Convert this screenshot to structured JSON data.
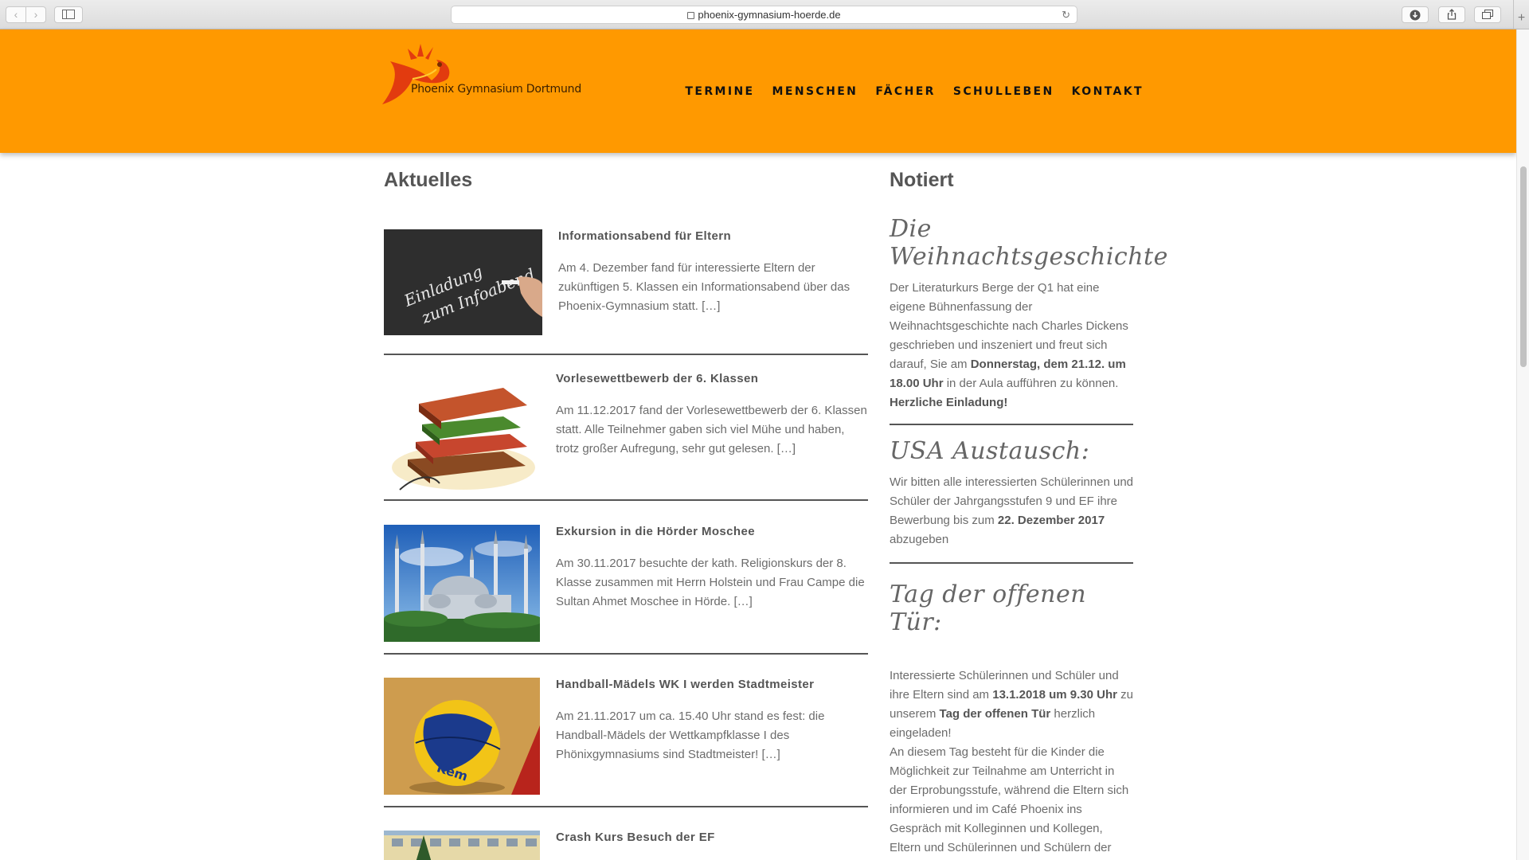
{
  "browser": {
    "url": "phoenix-gymnasium-hoerde.de",
    "back_glyph": "‹",
    "forward_glyph": "›",
    "reload_glyph": "↻",
    "new_tab_glyph": "+"
  },
  "site": {
    "logo_text": "Phoenix Gymnasium Dortmund",
    "nav": [
      "TERMINE",
      "MENSCHEN",
      "FÄCHER",
      "SCHULLEBEN",
      "KONTAKT"
    ],
    "colors": {
      "header": "#ff9900",
      "text": "#555555"
    }
  },
  "aktuelles": {
    "title": "Aktuelles",
    "chalkboard_text": [
      "Einladung",
      "zum Infoabend"
    ],
    "posts": [
      {
        "title": "Informationsabend für Eltern",
        "excerpt": "Am 4. Dezember fand für interessierte Eltern der zukünftigen 5. Klassen ein Informationsabend über das Phoenix-Gymnasium statt.",
        "more": "[…]",
        "image": "chalkboard-image"
      },
      {
        "title": "Vorlesewettbewerb der 6. Klassen",
        "excerpt": "Am 11.12.2017 fand der Vorlesewettbewerb der 6. Klassen statt. Alle Teilnehmer gaben sich viel Mühe und haben, trotz großer Aufregung, sehr gut gelesen.",
        "more": "[…]",
        "image": "books-image"
      },
      {
        "title": "Exkursion in die Hörder Moschee",
        "excerpt": "Am 30.11.2017 besuchte der kath. Religionskurs der 8. Klasse zusammen mit Herrn Holstein und Frau Campe die Sultan Ahmet Moschee in Hörde.",
        "more": "[…]",
        "image": "mosque-image"
      },
      {
        "title": "Handball-Mädels WK I werden Stadtmeister",
        "excerpt": "Am 21.11.2017 um ca. 15.40 Uhr stand es fest: die Handball-Mädels der Wettkampfklasse I des Phönixgymnasiums sind Stadtmeister!",
        "more": "[…]",
        "image": "handball-image"
      },
      {
        "title": "Crash Kurs Besuch der EF",
        "image": "building-image"
      }
    ]
  },
  "notiert": {
    "title": "Notiert",
    "items": [
      {
        "heading": "Die Weihnachtsgeschichte",
        "text_a": "Der Literaturkurs Berge der Q1 hat eine eigene Bühnenfassung der Weihnachtsgeschichte nach Charles Dickens geschrieben und inszeniert und freut sich darauf, Sie am ",
        "bold_a": "Donnerstag, dem 21.12. um 18.00 Uhr",
        "text_b": " in der Aula aufführen zu können.",
        "bold_b": "Herzliche Einladung!"
      },
      {
        "heading": "USA Austausch:",
        "text_a": "Wir bitten alle interessierten Schülerinnen und Schüler der Jahrgangsstufen 9 und EF ihre Bewerbung bis zum ",
        "bold_a": "22. Dezember 2017",
        "text_b": " abzugeben"
      },
      {
        "heading": "Tag der offenen Tür:",
        "text_a": "Interessierte Schülerinnen und Schüler und ihre Eltern sind am ",
        "bold_a": "13.1.2018 um 9.30 Uhr",
        "text_b": " zu unserem ",
        "bold_b": "Tag der offenen Tür",
        "text_c": " herzlich eingeladen!",
        "text_d": "An diesem Tag besteht für die Kinder die Möglichkeit zur Teilnahme am Unterricht in der Erprobungsstufe, während die Eltern sich informieren und im Café Phoenix ins Gespräch mit Kolleginnen und Kollegen, Eltern und Schülerinnen und Schülern der Schule kommen können."
      }
    ]
  }
}
